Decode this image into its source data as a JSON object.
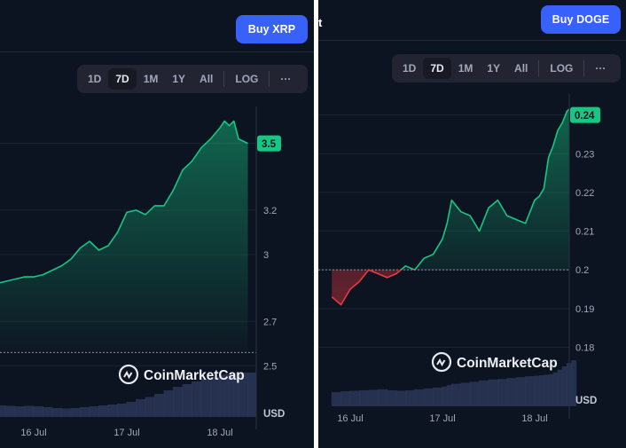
{
  "colors": {
    "up": "#16c784",
    "down": "#ea3943",
    "accent": "#3861fb",
    "bg": "#0d1421"
  },
  "left": {
    "title_fragment": "",
    "buy_label": "Buy XRP",
    "timeframes": [
      "1D",
      "7D",
      "1M",
      "1Y",
      "All"
    ],
    "active_timeframe": "7D",
    "log_label": "LOG",
    "more_label": "···",
    "watermark": "CoinMarketCap",
    "currency": "USD"
  },
  "right": {
    "title_fragment": "t",
    "buy_label": "Buy DOGE",
    "timeframes": [
      "1D",
      "7D",
      "1M",
      "1Y",
      "All"
    ],
    "active_timeframe": "7D",
    "log_label": "LOG",
    "more_label": "···",
    "watermark": "CoinMarketCap",
    "currency": "USD"
  },
  "chart_data": [
    {
      "type": "area",
      "series_label": "XRP",
      "xticks": [
        "16 Jul",
        "17 Jul",
        "18 Jul"
      ],
      "yticks": [
        2.5,
        2.7,
        3.0,
        3.2,
        3.5
      ],
      "ylim": [
        2.45,
        3.65
      ],
      "baseline": 2.56,
      "current_price": 3.5,
      "current_price_label": "3.5",
      "x": [
        -0.95,
        -0.8,
        -0.7,
        -0.6,
        -0.5,
        -0.4,
        -0.3,
        -0.2,
        -0.1,
        0.0,
        0.1,
        0.2,
        0.3,
        0.4,
        0.5,
        0.6,
        0.7,
        0.8,
        0.9,
        1.0,
        1.1,
        1.2,
        1.3,
        1.4,
        1.5,
        1.6,
        1.7,
        1.8,
        1.9,
        2.0,
        2.05,
        2.1,
        2.15,
        2.2,
        2.3
      ],
      "y": [
        2.88,
        2.89,
        2.88,
        2.9,
        2.89,
        2.87,
        2.88,
        2.89,
        2.9,
        2.9,
        2.91,
        2.93,
        2.95,
        2.98,
        3.03,
        3.06,
        3.02,
        3.04,
        3.1,
        3.19,
        3.2,
        3.18,
        3.22,
        3.22,
        3.29,
        3.38,
        3.42,
        3.48,
        3.52,
        3.57,
        3.6,
        3.58,
        3.6,
        3.52,
        3.5
      ],
      "volume": [
        0.25,
        0.27,
        0.26,
        0.27,
        0.28,
        0.26,
        0.25,
        0.24,
        0.25,
        0.24,
        0.22,
        0.2,
        0.19,
        0.2,
        0.22,
        0.24,
        0.26,
        0.28,
        0.3,
        0.34,
        0.4,
        0.45,
        0.52,
        0.6,
        0.68,
        0.74,
        0.8,
        0.86,
        0.9,
        0.95,
        0.97,
        0.98,
        0.99,
        1.0,
        1.0
      ]
    },
    {
      "type": "area",
      "series_label": "DOGE",
      "xticks": [
        "16 Jul",
        "17 Jul",
        "18 Jul"
      ],
      "yticks": [
        0.18,
        0.19,
        0.2,
        0.21,
        0.22,
        0.23,
        0.24
      ],
      "ylim": [
        0.173,
        0.2445
      ],
      "baseline": 0.2,
      "current_price": 0.24,
      "current_price_label": "0.24",
      "x": [
        -0.2,
        -0.1,
        0.0,
        0.1,
        0.2,
        0.3,
        0.4,
        0.5,
        0.6,
        0.7,
        0.8,
        0.9,
        1.0,
        1.05,
        1.1,
        1.2,
        1.3,
        1.4,
        1.5,
        1.6,
        1.7,
        1.8,
        1.9,
        2.0,
        2.05,
        2.1,
        2.15,
        2.2,
        2.25,
        2.3,
        2.35,
        2.4,
        2.45
      ],
      "y": [
        0.193,
        0.191,
        0.195,
        0.197,
        0.2,
        0.199,
        0.198,
        0.199,
        0.201,
        0.2,
        0.203,
        0.204,
        0.208,
        0.212,
        0.218,
        0.215,
        0.214,
        0.21,
        0.216,
        0.218,
        0.214,
        0.213,
        0.212,
        0.218,
        0.219,
        0.221,
        0.229,
        0.232,
        0.236,
        0.238,
        0.241,
        0.242,
        0.241
      ],
      "volume": [
        0.3,
        0.32,
        0.33,
        0.34,
        0.35,
        0.36,
        0.34,
        0.33,
        0.34,
        0.36,
        0.38,
        0.4,
        0.42,
        0.45,
        0.48,
        0.5,
        0.52,
        0.55,
        0.57,
        0.58,
        0.6,
        0.62,
        0.64,
        0.65,
        0.66,
        0.67,
        0.68,
        0.72,
        0.78,
        0.85,
        0.92,
        0.98,
        1.0
      ]
    }
  ]
}
